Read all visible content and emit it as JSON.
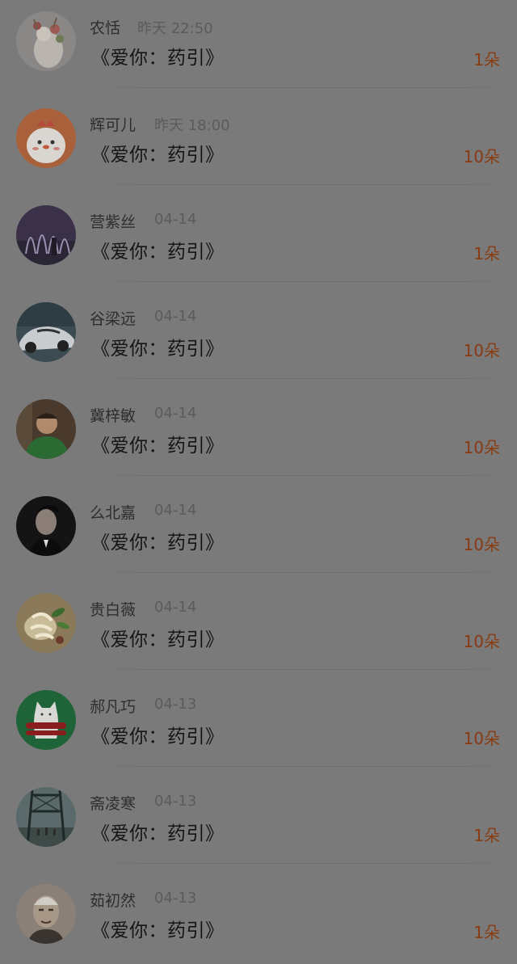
{
  "gifts": [
    {
      "name": "农恬",
      "time": "昨天 22:50",
      "title": "《爱你：药引》",
      "count": "1朵",
      "avatar_icon": "deer-flower-avatar"
    },
    {
      "name": "辉可儿",
      "time": "昨天 18:00",
      "title": "《爱你：药引》",
      "count": "10朵",
      "avatar_icon": "cartoon-chick-avatar"
    },
    {
      "name": "营紫丝",
      "time": "04-14",
      "title": "《爱你：药引》",
      "count": "1朵",
      "avatar_icon": "fountain-night-avatar"
    },
    {
      "name": "谷梁远",
      "time": "04-14",
      "title": "《爱你：药引》",
      "count": "10朵",
      "avatar_icon": "sports-car-avatar"
    },
    {
      "name": "冀梓敏",
      "time": "04-14",
      "title": "《爱你：药引》",
      "count": "10朵",
      "avatar_icon": "boy-green-shirt-avatar"
    },
    {
      "name": "么北嘉",
      "time": "04-14",
      "title": "《爱你：药引》",
      "count": "10朵",
      "avatar_icon": "man-dark-portrait-avatar"
    },
    {
      "name": "贵白薇",
      "time": "04-14",
      "title": "《爱你：药引》",
      "count": "10朵",
      "avatar_icon": "flower-plant-avatar"
    },
    {
      "name": "郝凡巧",
      "time": "04-13",
      "title": "《爱你：药引》",
      "count": "10朵",
      "avatar_icon": "white-cat-green-avatar"
    },
    {
      "name": "斋凌寒",
      "time": "04-13",
      "title": "《爱你：药引》",
      "count": "1朵",
      "avatar_icon": "bridge-people-avatar"
    },
    {
      "name": "茹初然",
      "time": "04-13",
      "title": "《爱你：药引》",
      "count": "1朵",
      "avatar_icon": "old-man-portrait-avatar"
    }
  ],
  "colors": {
    "background": "#7a7a7a",
    "count_accent": "#8a3a12"
  }
}
